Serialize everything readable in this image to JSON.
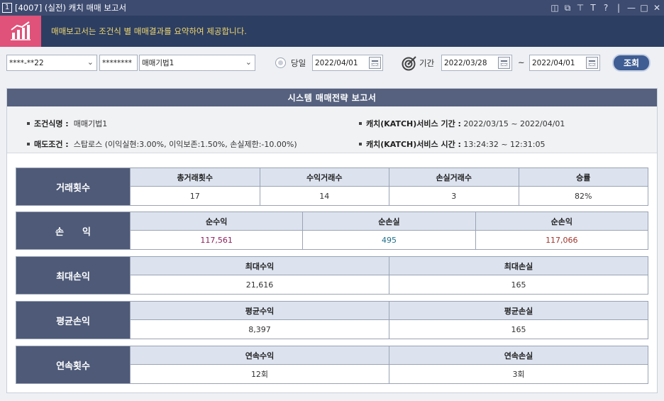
{
  "window": {
    "number": "1",
    "title": "[4007] (실전) 캐치 매매 보고서"
  },
  "banner": {
    "message": "매매보고서는 조건식 별 매매결과를 요약하여 제공합니다."
  },
  "toolbar": {
    "account": "****-**22",
    "password": "********",
    "strategy": "매매기법1",
    "today_label": "당일",
    "today_date": "2022/04/01",
    "period_label": "기간",
    "period_start": "2022/03/28",
    "period_sep": "~",
    "period_end": "2022/04/01",
    "query_label": "조회"
  },
  "report": {
    "title": "시스템 매매전략 보고서",
    "conditions": {
      "name_label": "조건식명 :",
      "name_value": "매매기법1",
      "sell_label": "매도조건 :",
      "sell_value": "스탑로스 (이익실현:3.00%, 이익보존:1.50%, 손실제한:-10.00%)",
      "period_label": "캐치(KATCH)서비스 기간 :",
      "period_value": "2022/03/15 ~ 2022/04/01",
      "time_label": "캐치(KATCH)서비스 시간 :",
      "time_value": "13:24:32 ~ 12:31:05"
    },
    "groups": [
      {
        "label": "거래횟수",
        "columns": [
          {
            "header": "총거래횟수",
            "value": "17"
          },
          {
            "header": "수익거래수",
            "value": "14"
          },
          {
            "header": "손실거래수",
            "value": "3"
          },
          {
            "header": "승률",
            "value": "82%"
          }
        ]
      },
      {
        "label": "손　　익",
        "columns": [
          {
            "header": "순수익",
            "value": "117,561"
          },
          {
            "header": "순손실",
            "value": "495"
          },
          {
            "header": "순손익",
            "value": "117,066"
          }
        ]
      },
      {
        "label": "최대손익",
        "columns": [
          {
            "header": "최대수익",
            "value": "21,616"
          },
          {
            "header": "최대손실",
            "value": "165"
          }
        ]
      },
      {
        "label": "평균손익",
        "columns": [
          {
            "header": "평균수익",
            "value": "8,397"
          },
          {
            "header": "평균손실",
            "value": "165"
          }
        ]
      },
      {
        "label": "연속횟수",
        "columns": [
          {
            "header": "연속수익",
            "value": "12회"
          },
          {
            "header": "연속손실",
            "value": "3회"
          }
        ]
      }
    ]
  },
  "colors": {
    "profit": "#8b1e5a",
    "loss": "#1f6f8b",
    "net": "#a0332a"
  }
}
